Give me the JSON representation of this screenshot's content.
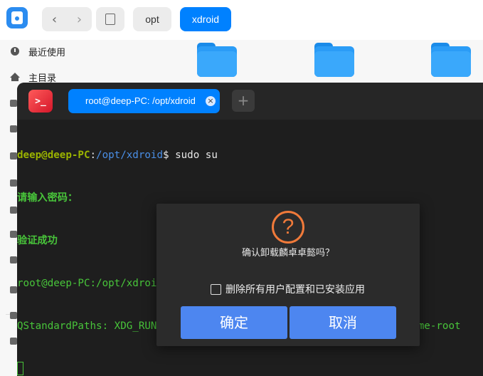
{
  "file_manager": {
    "app_icon": "file-manager-icon",
    "nav": {
      "back_icon": "chevron-left-icon",
      "forward_icon": "chevron-right-icon",
      "back_glyph": "‹",
      "forward_glyph": "›"
    },
    "disk_icon": "disk-icon",
    "breadcrumbs": [
      "opt",
      "xdroid"
    ],
    "active_breadcrumb": "xdroid",
    "sidebar": [
      {
        "label": "最近使用",
        "icon": "clock-icon"
      },
      {
        "label": "主目录",
        "icon": "home-icon"
      }
    ],
    "folder_icon": "folder-icon",
    "colors": {
      "accent": "#0081ff",
      "folder": "#3aa8fb"
    }
  },
  "terminal": {
    "logo_icon": "terminal-icon",
    "logo_glyph": ">_",
    "tab_title": "root@deep-PC: /opt/xdroid",
    "tab_close_glyph": "×",
    "add_tab_glyph": "+",
    "lines": {
      "l1_user": "deep@deep-PC",
      "l1_sep": ":",
      "l1_path": "/opt/xdroid",
      "l1_cmd": "$ sudo su",
      "l2": "请输入密码：",
      "l3": "验证成功",
      "l4": "root@deep-PC:/opt/xdroid# ./uninstall",
      "l5": "QStandardPaths: XDG_RUNTIME_DIR not set, defaulting to '/tmp/runtime-root"
    },
    "colors": {
      "user": "#9ab300",
      "path": "#4a8fe7",
      "green": "#48c43a"
    }
  },
  "dialog": {
    "icon": "question-icon",
    "icon_glyph": "?",
    "message": "确认卸载麟卓卓懿吗？",
    "checkbox_label": "删除所有用户配置和已安装应用",
    "checkbox_checked": false,
    "confirm_label": "确定",
    "cancel_label": "取消",
    "colors": {
      "button": "#4d86f0",
      "icon": "#f07a3a"
    }
  }
}
